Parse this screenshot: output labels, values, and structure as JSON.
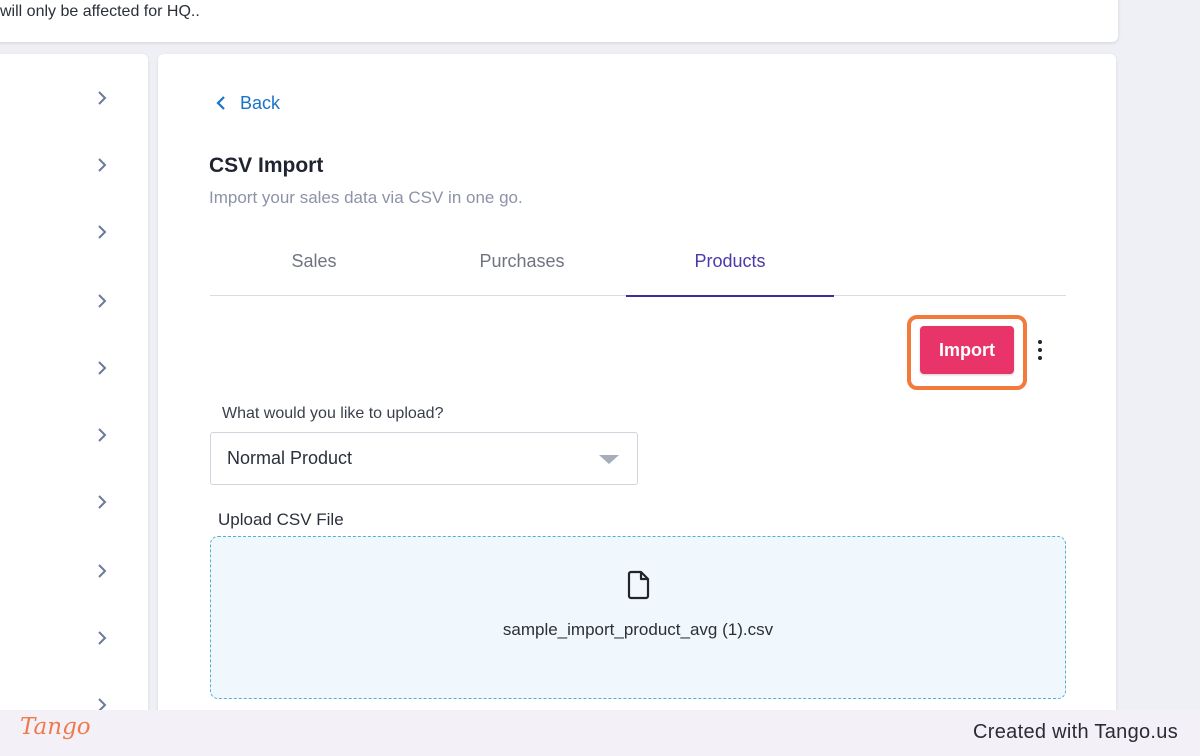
{
  "notice": {
    "text": "will only be affected for HQ.."
  },
  "sidebar": {
    "chevron_count": 10
  },
  "header": {
    "back_label": "Back",
    "title": "CSV Import",
    "subtitle": "Import your sales data via CSV in one go."
  },
  "tabs": [
    {
      "label": "Sales",
      "active": false
    },
    {
      "label": "Purchases",
      "active": false
    },
    {
      "label": "Products",
      "active": true
    }
  ],
  "toolbar": {
    "import_label": "Import",
    "more_icon": "kebab-menu-icon"
  },
  "form": {
    "question_label": "What would you like to upload?",
    "upload_type_value": "Normal Product",
    "upload_label": "Upload CSV File",
    "file_name": "sample_import_product_avg (1).csv",
    "file_icon": "file-icon"
  },
  "footer": {
    "logo_text": "Tango",
    "credit_text": "Created with Tango.us"
  },
  "colors": {
    "accent": "#e9346a",
    "highlight": "#f27a3b",
    "link": "#1a73c8",
    "active_tab": "#4b3aa8",
    "dropzone_border": "#52b1d3"
  }
}
